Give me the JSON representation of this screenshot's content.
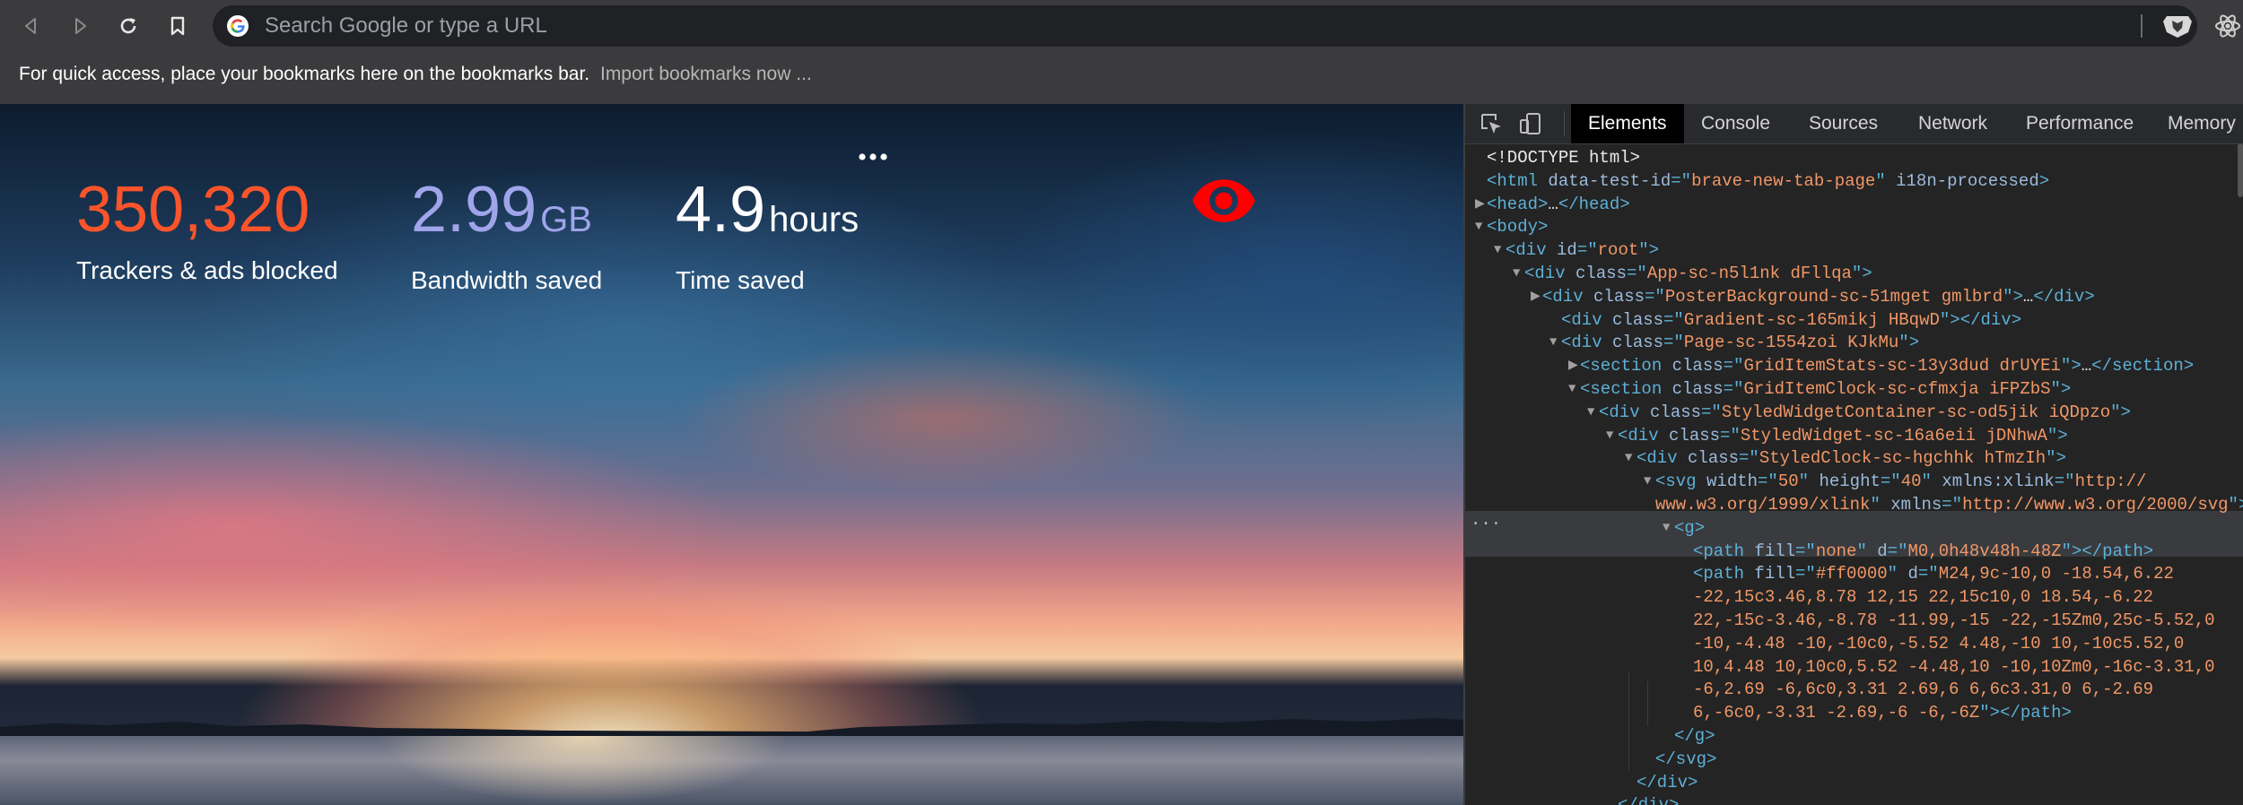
{
  "toolbar": {
    "back_icon": "back-arrow-icon",
    "forward_icon": "forward-arrow-icon",
    "reload_icon": "reload-icon",
    "bookmark_icon": "bookmark-icon",
    "omnibox_placeholder": "Search Google or type a URL"
  },
  "bookmarks_bar": {
    "message": "For quick access, place your bookmarks here on the bookmarks bar.",
    "import_link": "Import bookmarks now ..."
  },
  "ntp": {
    "stats": {
      "trackers": {
        "value": "350,320",
        "label": "Trackers & ads blocked"
      },
      "bandwidth": {
        "value": "2.99",
        "unit": "GB",
        "label": "Bandwidth saved"
      },
      "time": {
        "value": "4.9",
        "unit": "hours",
        "label": "Time saved"
      }
    },
    "colors": {
      "trackers": "#fb542b",
      "bandwidth": "#a0a5eb",
      "clock_icon": "#ff0000"
    }
  },
  "devtools": {
    "tabs": [
      "Elements",
      "Console",
      "Sources",
      "Network",
      "Performance",
      "Memory"
    ],
    "active_tab": "Elements",
    "lines": [
      {
        "tri": "",
        "parts": [
          [
            "txt",
            "<!DOCTYPE html>"
          ]
        ]
      },
      {
        "tri": "",
        "parts": [
          [
            "tag",
            "<html "
          ],
          [
            "attr",
            "data-test-id"
          ],
          [
            "tag",
            "=\""
          ],
          [
            "val",
            "brave-new-tab-page"
          ],
          [
            "tag",
            "\" "
          ],
          [
            "attr",
            "i18n-processed"
          ],
          [
            "tag",
            ">"
          ]
        ]
      },
      {
        "tri": "▶",
        "parts": [
          [
            "tag",
            "<head>"
          ],
          [
            "txt",
            "…"
          ],
          [
            "tag",
            "</head>"
          ]
        ]
      },
      {
        "tri": "▼",
        "parts": [
          [
            "tag",
            "<body>"
          ]
        ]
      },
      {
        "tri": "▼",
        "parts": [
          [
            "tag",
            "<div "
          ],
          [
            "attr",
            "id"
          ],
          [
            "tag",
            "=\""
          ],
          [
            "val",
            "root"
          ],
          [
            "tag",
            "\">"
          ]
        ]
      },
      {
        "tri": "▼",
        "parts": [
          [
            "tag",
            "<div "
          ],
          [
            "attr",
            "class"
          ],
          [
            "tag",
            "=\""
          ],
          [
            "val",
            "App-sc-n5l1nk dFllqa"
          ],
          [
            "tag",
            "\">"
          ]
        ]
      },
      {
        "tri": "▶",
        "parts": [
          [
            "tag",
            "<div "
          ],
          [
            "attr",
            "class"
          ],
          [
            "tag",
            "=\""
          ],
          [
            "val",
            "PosterBackground-sc-51mget gmlbrd"
          ],
          [
            "tag",
            "\">"
          ],
          [
            "txt",
            "…"
          ],
          [
            "tag",
            "</div>"
          ]
        ]
      },
      {
        "tri": "",
        "parts": [
          [
            "tag",
            "<div "
          ],
          [
            "attr",
            "class"
          ],
          [
            "tag",
            "=\""
          ],
          [
            "val",
            "Gradient-sc-165mikj HBqwD"
          ],
          [
            "tag",
            "\"></div>"
          ]
        ]
      },
      {
        "tri": "▼",
        "parts": [
          [
            "tag",
            "<div "
          ],
          [
            "attr",
            "class"
          ],
          [
            "tag",
            "=\""
          ],
          [
            "val",
            "Page-sc-1554zoi KJkMu"
          ],
          [
            "tag",
            "\">"
          ]
        ]
      },
      {
        "tri": "▶",
        "parts": [
          [
            "tag",
            "<section "
          ],
          [
            "attr",
            "class"
          ],
          [
            "tag",
            "=\""
          ],
          [
            "val",
            "GridItemStats-sc-13y3dud drUYEi"
          ],
          [
            "tag",
            "\">"
          ],
          [
            "txt",
            "…"
          ],
          [
            "tag",
            "</section>"
          ]
        ]
      },
      {
        "tri": "▼",
        "parts": [
          [
            "tag",
            "<section "
          ],
          [
            "attr",
            "class"
          ],
          [
            "tag",
            "=\""
          ],
          [
            "val",
            "GridItemClock-sc-cfmxja iFPZbS"
          ],
          [
            "tag",
            "\">"
          ]
        ]
      },
      {
        "tri": "▼",
        "parts": [
          [
            "tag",
            "<div "
          ],
          [
            "attr",
            "class"
          ],
          [
            "tag",
            "=\""
          ],
          [
            "val",
            "StyledWidgetContainer-sc-od5jik iQDpzo"
          ],
          [
            "tag",
            "\">"
          ]
        ]
      },
      {
        "tri": "▼",
        "parts": [
          [
            "tag",
            "<div "
          ],
          [
            "attr",
            "class"
          ],
          [
            "tag",
            "=\""
          ],
          [
            "val",
            "StyledWidget-sc-16a6eii jDNhwA"
          ],
          [
            "tag",
            "\">"
          ]
        ]
      },
      {
        "tri": "▼",
        "parts": [
          [
            "tag",
            "<div "
          ],
          [
            "attr",
            "class"
          ],
          [
            "tag",
            "=\""
          ],
          [
            "val",
            "StyledClock-sc-hgchhk hTmzIh"
          ],
          [
            "tag",
            "\">"
          ]
        ]
      },
      {
        "tri": "▼",
        "parts": [
          [
            "tag",
            "<svg "
          ],
          [
            "attr",
            "width"
          ],
          [
            "tag",
            "=\""
          ],
          [
            "val",
            "50"
          ],
          [
            "tag",
            "\" "
          ],
          [
            "attr",
            "height"
          ],
          [
            "tag",
            "=\""
          ],
          [
            "val",
            "40"
          ],
          [
            "tag",
            "\" "
          ],
          [
            "attr",
            "xmlns:xlink"
          ],
          [
            "tag",
            "=\""
          ],
          [
            "val",
            "http://"
          ]
        ]
      },
      {
        "tri": "",
        "parts": [
          [
            "val",
            "www.w3.org/1999/xlink"
          ],
          [
            "tag",
            "\" "
          ],
          [
            "attr",
            "xmlns"
          ],
          [
            "tag",
            "=\""
          ],
          [
            "val",
            "http://www.w3.org/2000/svg"
          ],
          [
            "tag",
            "\">"
          ]
        ]
      },
      {
        "tri": "▼",
        "parts": [
          [
            "tag",
            "<g>"
          ]
        ]
      },
      {
        "tri": "",
        "parts": [
          [
            "tag",
            "<path "
          ],
          [
            "attr",
            "fill"
          ],
          [
            "tag",
            "=\""
          ],
          [
            "val",
            "none"
          ],
          [
            "tag",
            "\" "
          ],
          [
            "attr",
            "d"
          ],
          [
            "tag",
            "=\""
          ],
          [
            "val",
            "M0,0h48v48h-48Z"
          ],
          [
            "tag",
            "\"></path>"
          ]
        ]
      },
      {
        "tri": "",
        "parts": [
          [
            "tag",
            "<path "
          ],
          [
            "attr",
            "fill"
          ],
          [
            "tag",
            "=\""
          ],
          [
            "val",
            "#ff0000"
          ],
          [
            "tag",
            "\" "
          ],
          [
            "attr",
            "d"
          ],
          [
            "tag",
            "=\""
          ],
          [
            "val",
            "M24,9c-10,0 -18.54,6.22"
          ]
        ]
      },
      {
        "tri": "",
        "parts": [
          [
            "val",
            "-22,15c3.46,8.78 12,15 22,15c10,0 18.54,-6.22"
          ]
        ]
      },
      {
        "tri": "",
        "parts": [
          [
            "val",
            "22,-15c-3.46,-8.78 -11.99,-15 -22,-15Zm0,25c-5.52,0"
          ]
        ]
      },
      {
        "tri": "",
        "parts": [
          [
            "val",
            "-10,-4.48 -10,-10c0,-5.52 4.48,-10 10,-10c5.52,0"
          ]
        ]
      },
      {
        "tri": "",
        "parts": [
          [
            "val",
            "10,4.48 10,10c0,5.52 -4.48,10 -10,10Zm0,-16c-3.31,0"
          ]
        ]
      },
      {
        "tri": "",
        "parts": [
          [
            "val",
            "-6,2.69 -6,6c0,3.31 2.69,6 6,6c3.31,0 6,-2.69"
          ]
        ]
      },
      {
        "tri": "",
        "parts": [
          [
            "val",
            "6,-6c0,-3.31 -2.69,-6 -6,-6Z"
          ],
          [
            "tag",
            "\"></path>"
          ]
        ]
      },
      {
        "tri": "",
        "parts": [
          [
            "tag",
            "</g>"
          ]
        ]
      },
      {
        "tri": "",
        "parts": [
          [
            "tag",
            "</svg>"
          ]
        ]
      },
      {
        "tri": "",
        "parts": [
          [
            "tag",
            "</div>"
          ]
        ]
      },
      {
        "tri": "",
        "parts": [
          [
            "tag",
            "</div>"
          ]
        ]
      }
    ]
  }
}
